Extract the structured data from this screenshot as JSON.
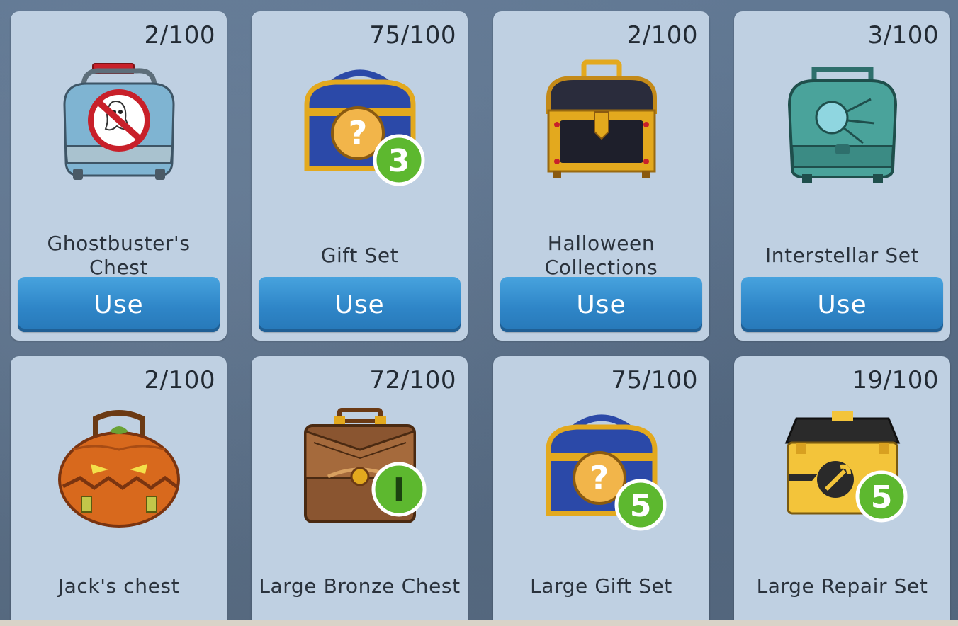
{
  "items": [
    {
      "count": "2/100",
      "name": "Ghostbuster's Chest",
      "button": "Use",
      "icon": "ghostbusters-chest-icon"
    },
    {
      "count": "75/100",
      "name": "Gift Set",
      "button": "Use",
      "icon": "gift-set-chest-icon",
      "badge": "3"
    },
    {
      "count": "2/100",
      "name": "Halloween Collections",
      "button": "Use",
      "icon": "halloween-treasure-chest-icon"
    },
    {
      "count": "3/100",
      "name": "Interstellar Set",
      "button": "Use",
      "icon": "interstellar-chest-icon"
    },
    {
      "count": "2/100",
      "name": "Jack's chest",
      "icon": "pumpkin-chest-icon"
    },
    {
      "count": "72/100",
      "name": "Large Bronze Chest",
      "icon": "bronze-briefcase-icon",
      "badge": "I"
    },
    {
      "count": "75/100",
      "name": "Large Gift Set",
      "icon": "large-gift-set-chest-icon",
      "badge": "5"
    },
    {
      "count": "19/100",
      "name": "Large Repair Set",
      "icon": "repair-toolbox-icon",
      "badge": "5"
    }
  ],
  "colors": {
    "card": "#bfd0e2",
    "button": "#2f86c8",
    "badge": "#5db82f",
    "gold": "#e3a91e",
    "blue_chest": "#2b49a8"
  }
}
